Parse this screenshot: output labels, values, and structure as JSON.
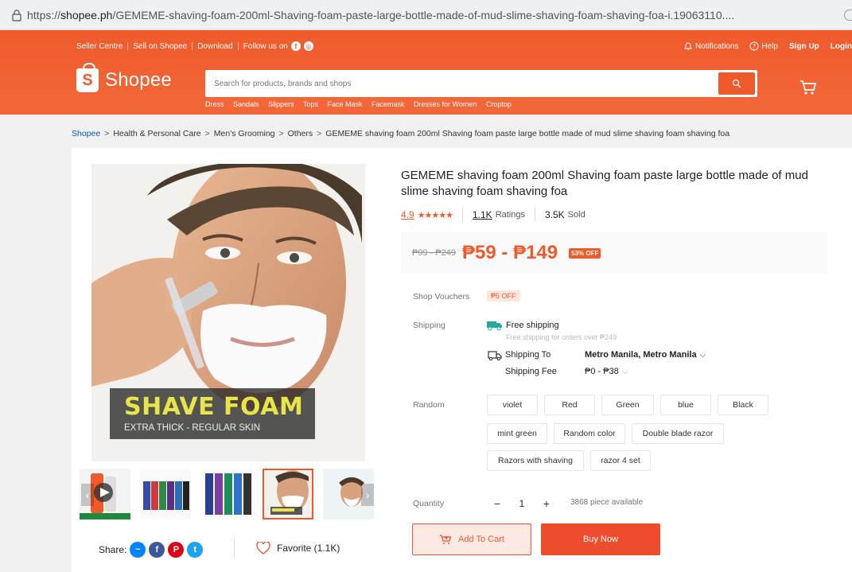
{
  "browser": {
    "url_prefix": "https://",
    "url_host": "shopee.ph",
    "url_path": "/GEMEME-shaving-foam-200ml-Shaving-foam-paste-large-bottle-made-of-mud-slime-shaving-foam-shaving-foa-i.19063110...."
  },
  "header": {
    "top_links": [
      "Seller Centre",
      "Sell on Shopee",
      "Download",
      "Follow us on"
    ],
    "notifications": "Notifications",
    "help": "Help",
    "signup": "Sign Up",
    "login": "Login",
    "brand": "Shopee",
    "search_placeholder": "Search for products, brands and shops",
    "keywords": [
      "Dress",
      "Sandals",
      "Slippers",
      "Tops",
      "Face Mask",
      "Facemask",
      "Dresses for Women",
      "Croptop"
    ]
  },
  "breadcrumb": [
    "Shopee",
    "Health & Personal Care",
    "Men's Grooming",
    "Others",
    "GEMEME shaving foam 200ml Shaving foam paste large bottle made of mud slime shaving foam shaving foa"
  ],
  "gallery": {
    "banner_title": "SHAVE FOAM",
    "banner_subtitle": "EXTRA THICK - REGULAR SKIN",
    "share_label": "Share:",
    "favorite_label": "Favorite (1.1K)"
  },
  "product": {
    "title": "GEMEME shaving foam 200ml Shaving foam paste large bottle made of mud slime shaving foam shaving foa",
    "rating": "4.9",
    "stars": "★★★★★",
    "ratings_count": "1.1K",
    "ratings_label": "Ratings",
    "sold_count": "3.5K",
    "sold_label": "Sold",
    "old_price": "₱99 - ₱249",
    "price": "₱59 - ₱149",
    "discount": "53% OFF"
  },
  "details": {
    "vouchers_label": "Shop Vouchers",
    "voucher": "₱5 OFF",
    "shipping_label": "Shipping",
    "free_shipping": "Free shipping",
    "free_shipping_note": "Free shipping for orders over ₱249",
    "shipping_to_label": "Shipping To",
    "shipping_to_value": "Metro Manila, Metro Manila",
    "shipping_fee_label": "Shipping Fee",
    "shipping_fee_value": "₱0 - ₱38",
    "variation_label": "Random",
    "variations": [
      "violet",
      "Red",
      "Green",
      "blue",
      "Black",
      "mint green",
      "Random color",
      "Double blade razor",
      "Razors with shaving",
      "razor 4 set"
    ],
    "quantity_label": "Quantity",
    "quantity_value": "1",
    "available": "3868 piece available",
    "add_to_cart": "Add To Cart",
    "buy_now": "Buy Now"
  },
  "colors": {
    "brand_orange": "#ee4d2d",
    "header_orange": "#f05a2b",
    "link_blue": "#0a55a7"
  }
}
